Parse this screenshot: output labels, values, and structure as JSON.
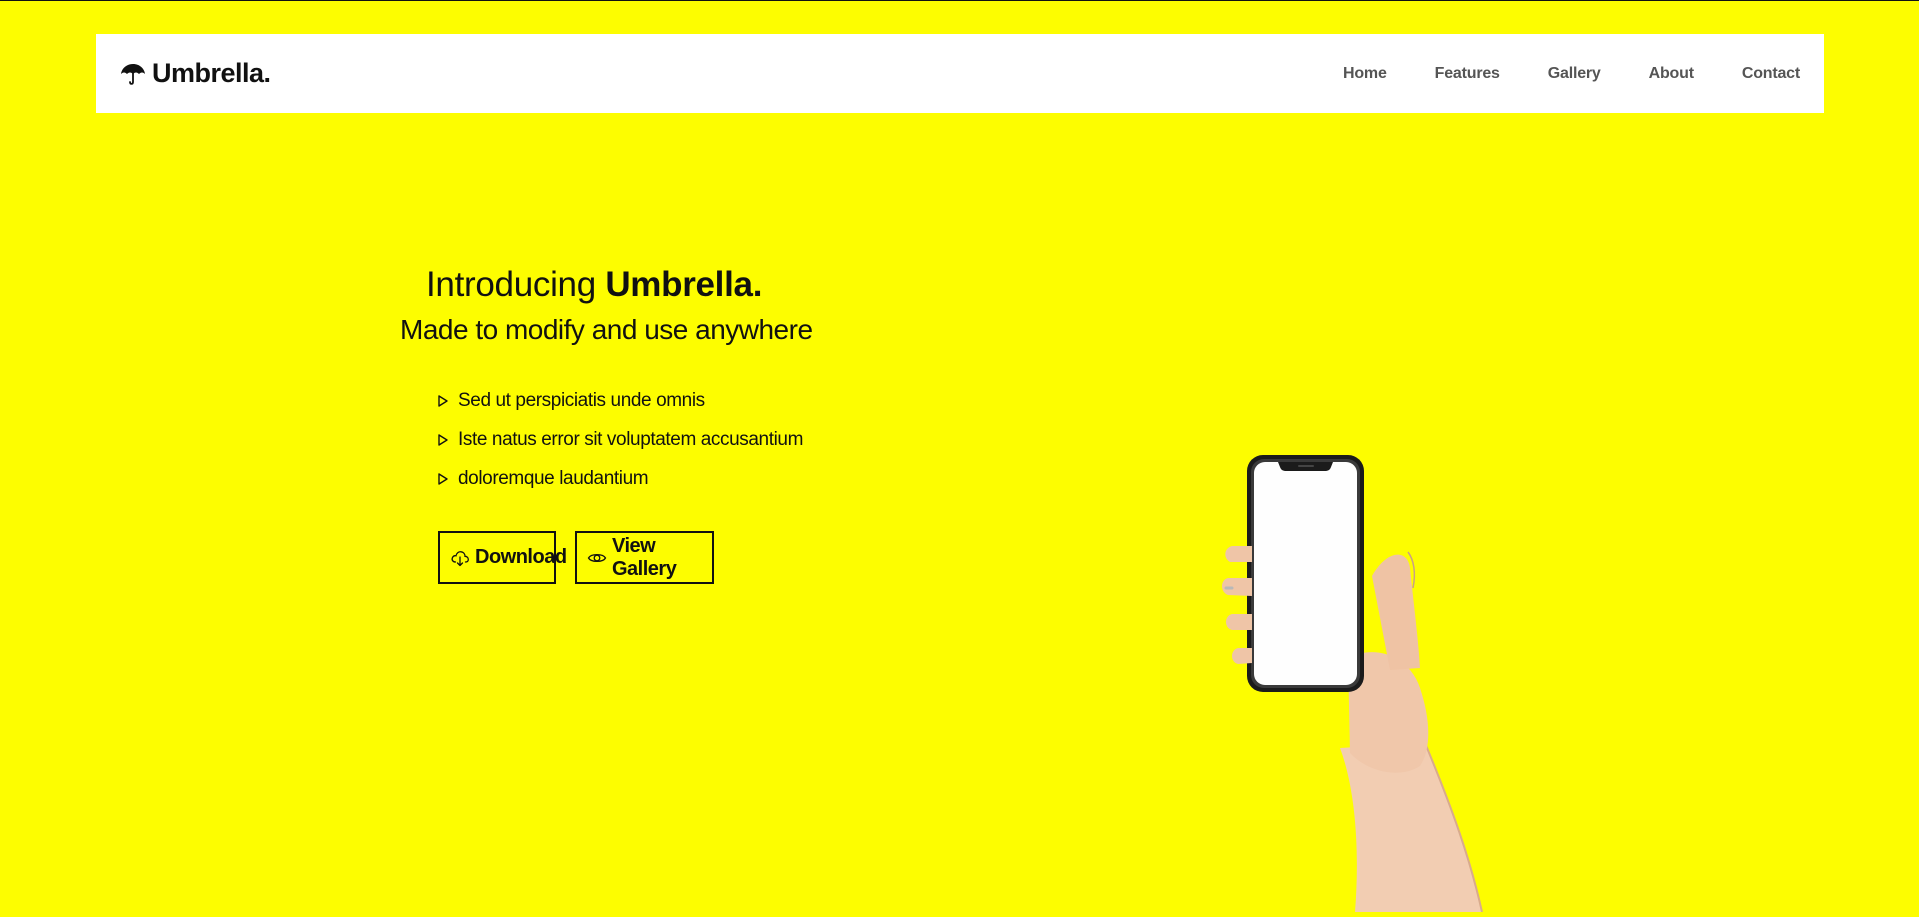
{
  "brand": {
    "name": "Umbrella.",
    "icon": "umbrella-icon"
  },
  "nav": {
    "items": [
      {
        "label": "Home"
      },
      {
        "label": "Features"
      },
      {
        "label": "Gallery"
      },
      {
        "label": "About"
      },
      {
        "label": "Contact"
      }
    ]
  },
  "hero": {
    "title_prefix": "Introducing",
    "title_bold": "Umbrella.",
    "subtitle": "Made to modify and use anywhere",
    "features": [
      {
        "text": "Sed ut perspiciatis unde omnis",
        "icon": "triangle-right-icon"
      },
      {
        "text": "Iste natus error sit voluptatem accusantium",
        "icon": "triangle-right-icon"
      },
      {
        "text": "doloremque laudantium",
        "icon": "triangle-right-icon"
      }
    ],
    "buttons": {
      "download": {
        "label": "Download",
        "icon": "cloud-download-icon"
      },
      "gallery": {
        "label": "View Gallery",
        "icon": "eye-icon"
      }
    }
  },
  "colors": {
    "background": "#fdfd00",
    "navbar": "#ffffff",
    "text": "#111111",
    "nav_text": "#555555"
  }
}
